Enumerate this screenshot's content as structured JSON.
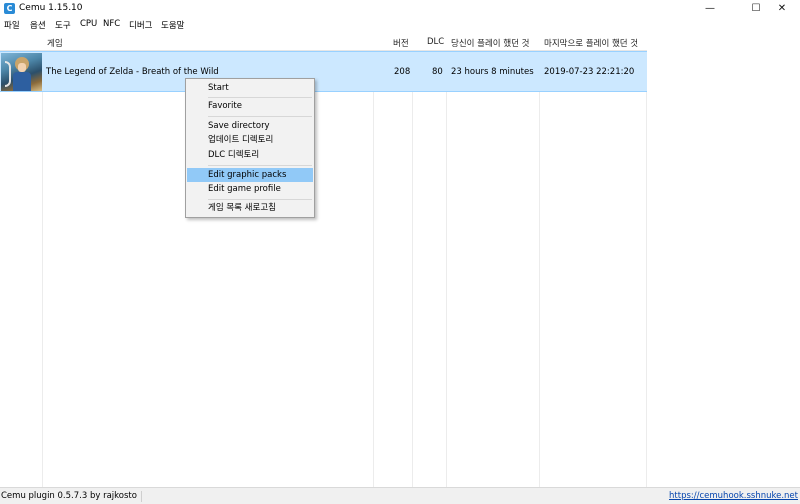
{
  "window": {
    "title": "Cemu 1.15.10",
    "icon_letter": "C",
    "minimize": "—",
    "maximize": "☐",
    "close": "✕"
  },
  "menu": [
    "파일",
    "옵션",
    "도구",
    "CPU",
    "NFC",
    "디버그",
    "도움말"
  ],
  "table": {
    "headers": {
      "game": "게임",
      "version": "버전",
      "dlc": "DLC",
      "played_time": "당신이 플레이 했던 것",
      "last_played": "마지막으로 플레이 했던 것"
    },
    "rows": [
      {
        "title": "The Legend of Zelda - Breath of the Wild",
        "version": "208",
        "dlc": "80",
        "played_time": "23 hours 8 minutes",
        "last_played": "2019-07-23 22:21:20"
      }
    ]
  },
  "context_menu": {
    "start": "Start",
    "favorite": "Favorite",
    "save_directory": "Save directory",
    "update_directory": "업데이트 디렉토리",
    "dlc_directory": "DLC 디렉토리",
    "edit_graphic_packs": "Edit graphic packs",
    "edit_game_profile": "Edit game profile",
    "refresh_game_list": "게임 목록 새로고침"
  },
  "status": {
    "plugin": "Cemu plugin 0.5.7.3 by rajkosto",
    "link": "https://cemuhook.sshnuke.net"
  }
}
